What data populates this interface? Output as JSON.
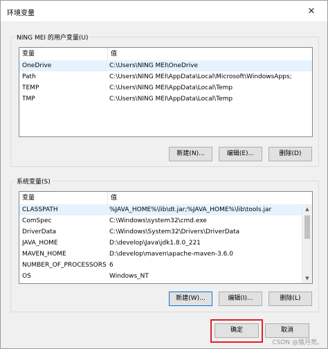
{
  "window": {
    "title": "环境变量",
    "close_glyph": "✕"
  },
  "user_vars": {
    "group_label": "NING MEI 的用户变量(U)",
    "columns": [
      "变量",
      "值"
    ],
    "rows": [
      [
        "OneDrive",
        "C:\\Users\\NING MEI\\OneDrive"
      ],
      [
        "Path",
        "C:\\Users\\NING MEI\\AppData\\Local\\Microsoft\\WindowsApps;"
      ],
      [
        "TEMP",
        "C:\\Users\\NING MEI\\AppData\\Local\\Temp"
      ],
      [
        "TMP",
        "C:\\Users\\NING MEI\\AppData\\Local\\Temp"
      ]
    ],
    "buttons": {
      "new": "新建(N)...",
      "edit": "编辑(E)...",
      "delete": "删除(D)"
    }
  },
  "system_vars": {
    "group_label": "系统变量(S)",
    "columns": [
      "变量",
      "值"
    ],
    "rows": [
      [
        "CLASSPATH",
        "%JAVA_HOME%\\lib\\dt.jar;%JAVA_HOME%\\lib\\tools.jar"
      ],
      [
        "ComSpec",
        "C:\\Windows\\system32\\cmd.exe"
      ],
      [
        "DriverData",
        "C:\\Windows\\System32\\Drivers\\DriverData"
      ],
      [
        "JAVA_HOME",
        "D:\\develop\\Java\\jdk1.8.0_221"
      ],
      [
        "MAVEN_HOME",
        "D:\\develop\\maven\\apache-maven-3.6.0"
      ],
      [
        "NUMBER_OF_PROCESSORS",
        "6"
      ],
      [
        "OS",
        "Windows_NT"
      ]
    ],
    "buttons": {
      "new": "新建(W)...",
      "edit": "编辑(I)...",
      "delete": "删除(L)"
    }
  },
  "footer": {
    "ok": "确定",
    "cancel": "取消"
  },
  "watermark": "CSDN @猿月亮。",
  "colors": {
    "selected_row": "#e5f3ff",
    "highlight": "#e0202a",
    "primary_border": "#0078d7"
  }
}
